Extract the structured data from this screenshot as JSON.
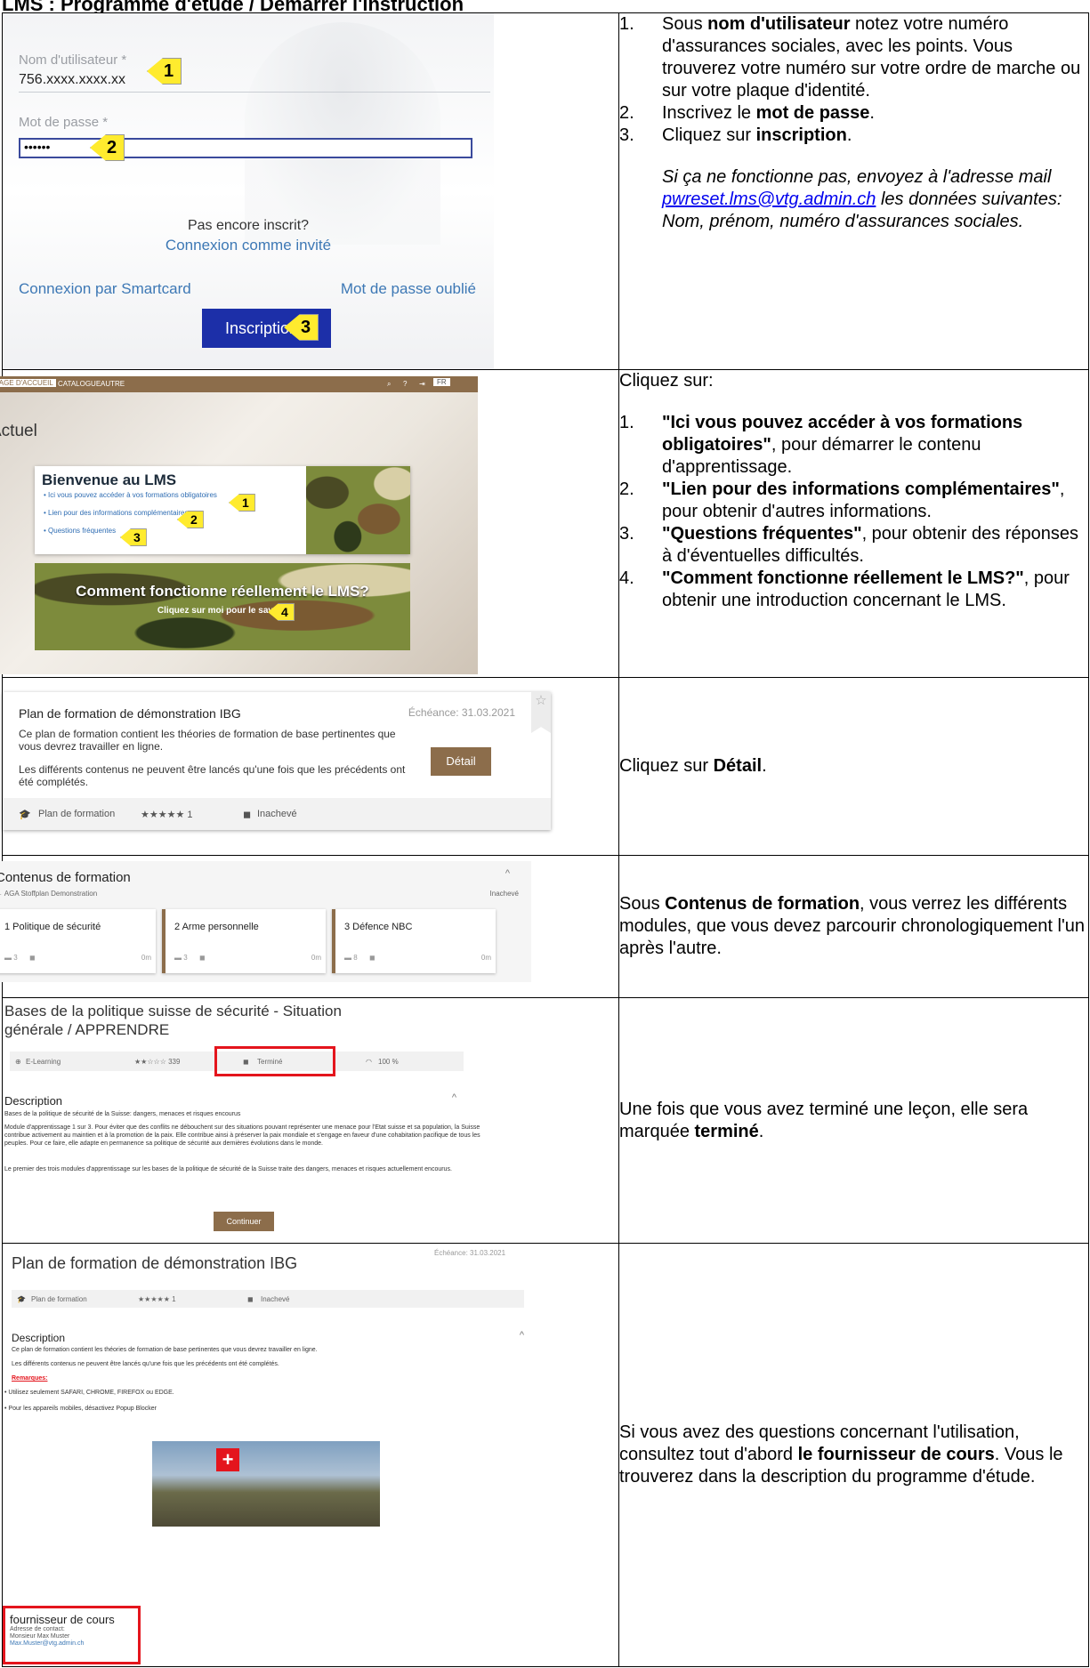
{
  "page_title": "LMS : Programme d'étude / Démarrer l'instruction",
  "row1": {
    "screenshot": {
      "username_label": "Nom d'utilisateur *",
      "username_value": "756.xxxx.xxxx.xx",
      "password_label": "Mot de passe *",
      "password_value": "••••••",
      "not_registered": "Pas encore inscrit?",
      "guest_link": "Connexion comme invité",
      "smartcard_link": "Connexion par Smartcard",
      "forgot_link": "Mot de passe oublié",
      "login_button": "Inscription",
      "callouts": [
        "1",
        "2",
        "3"
      ]
    },
    "steps": [
      {
        "n": "1.",
        "pre": "Sous ",
        "bold": "nom d'utilisateur",
        "post": " notez votre numéro d'assurances sociales, avec les points. Vous trouverez votre numéro sur votre ordre de marche ou sur votre plaque d'identité."
      },
      {
        "n": "2.",
        "pre": "Inscrivez le ",
        "bold": "mot de passe",
        "post": "."
      },
      {
        "n": "3.",
        "pre": "Cliquez sur ",
        "bold": "inscription",
        "post": "."
      }
    ],
    "note_pre": "Si ça ne fonctionne pas, envoyez à l'adresse mail ",
    "note_email": "pwreset.lms@vtg.admin.ch",
    "note_post": " les données suivantes: Nom, prénom, numéro d'assurances sociales."
  },
  "row2": {
    "screenshot": {
      "nav_home": "PAGE D'ACCUEIL",
      "nav_catalog": "CATALOGUE",
      "nav_other": "AUTRE",
      "nav_lang": "FR",
      "heading": "Actuel",
      "card_title": "Bienvenue au LMS",
      "card_links": [
        "Ici vous pouvez accéder à vos formations obligatoires",
        "Lien pour des informations complémentaires",
        "Questions fréquentes"
      ],
      "banner_title": "Comment fonctionne réellement le LMS?",
      "banner_sub": "Cliquez sur moi pour le savoir!",
      "callouts": [
        "1",
        "2",
        "3",
        "4"
      ]
    },
    "intro": "Cliquez sur:",
    "steps": [
      {
        "n": "1.",
        "bold": "\"Ici vous pouvez accéder à vos formations obligatoires\"",
        "post": ", pour démarrer le contenu d'apprentissage."
      },
      {
        "n": "2.",
        "bold": "\"Lien pour des informations complémentaires\"",
        "post": ", pour obtenir d'autres informations."
      },
      {
        "n": "3.",
        "bold": "\"Questions fréquentes\"",
        "post": ", pour obtenir des réponses à d'éventuelles difficultés."
      },
      {
        "n": "4.",
        "bold": "\"Comment fonctionne réellement le LMS?\"",
        "post": ", pour obtenir une introduction concernant le LMS."
      }
    ]
  },
  "row3": {
    "screenshot": {
      "title": "Plan de formation de démonstration IBG",
      "deadline": "Échéance: 31.03.2021",
      "p1": "Ce plan de formation contient les théories de formation de base pertinentes que vous devrez travailler en ligne.",
      "p2": "Les différents contenus ne peuvent être lancés qu'une fois que les précédents ont été complétés.",
      "button": "Détail",
      "footer_type": "Plan de formation",
      "footer_rating": "★★★★★ 1",
      "footer_status": "Inachevé"
    },
    "pre": "Cliquez sur ",
    "bold": "Détail",
    "post": "."
  },
  "row4": {
    "screenshot": {
      "title": "Contenus de formation",
      "sub": "AGA Stoffplan Demonstration",
      "status": "Inachevé",
      "modules": [
        {
          "title": "1 Politique de sécurité",
          "count": "3",
          "time": "0m"
        },
        {
          "title": "2 Arme personnelle",
          "count": "3",
          "time": "0m"
        },
        {
          "title": "3 Défence NBC",
          "count": "8",
          "time": "0m"
        }
      ]
    },
    "pre": "Sous ",
    "bold": "Contenus de formation",
    "post": ", vous verrez les différents modules, que vous devez parcourir chronologiquement l'un après l'autre."
  },
  "row5": {
    "screenshot": {
      "title": "Bases de la politique suisse de sécurité - Situation générale / APPRENDRE",
      "type": "E-Learning",
      "rating": "★★☆☆☆ 339",
      "status": "Terminé",
      "progress": "100 %",
      "desc_heading": "Description",
      "desc_lines": [
        "Bases de la politique de sécurité de la Suisse: dangers, menaces et risques encourus",
        "Module d'apprentissage 1 sur 3. Pour éviter que des conflits ne débouchent sur des situations pouvant représenter une menace pour l'Etat suisse et sa population, la Suisse contribue activement au maintien et à la promotion de la paix. Elle contribue ainsi à préserver la paix mondiale et s'engage en faveur d'une cohabitation pacifique de tous les peuples. Pour ce faire, elle adapte en permanence sa politique de sécurité aux dernières évolutions dans le monde.",
        "Le premier des trois modules d'apprentissage sur les bases de la politique de sécurité de la Suisse traite des dangers, menaces et risques actuellement encourus."
      ],
      "button": "Continuer"
    },
    "pre": "Une fois que vous avez terminé une leçon, elle sera marquée ",
    "bold": "terminé",
    "post": "."
  },
  "row6": {
    "screenshot": {
      "title": "Plan de formation de démonstration IBG",
      "deadline": "Échéance: 31.03.2021",
      "type": "Plan de formation",
      "rating": "★★★★★ 1",
      "status": "Inachevé",
      "desc_heading": "Description",
      "desc_p1": "Ce plan de formation contient les théories de formation de base pertinentes que vous devrez travailler en ligne.",
      "desc_p2": "Les différents contenus ne peuvent être lancés qu'une fois que les précédents ont été complétés.",
      "remarks": "Remarques:",
      "bullets": [
        "Utilisez seulement SAFARI, CHROME, FIREFOX ou EDGE.",
        "Pour les appareils mobiles, désactivez Popup Blocker"
      ],
      "provider_title": "fournisseur de cours",
      "provider_contact": "Adresse de contact:",
      "provider_name": "Monsieur Max Muster",
      "provider_email": "Max.Muster@vtg.admin.ch"
    },
    "pre": "Si vous avez des questions concernant l'utilisation, consultez tout d'abord ",
    "bold": "le fournisseur de cours",
    "post": ". Vous le trouverez dans la description du programme d'étude."
  }
}
